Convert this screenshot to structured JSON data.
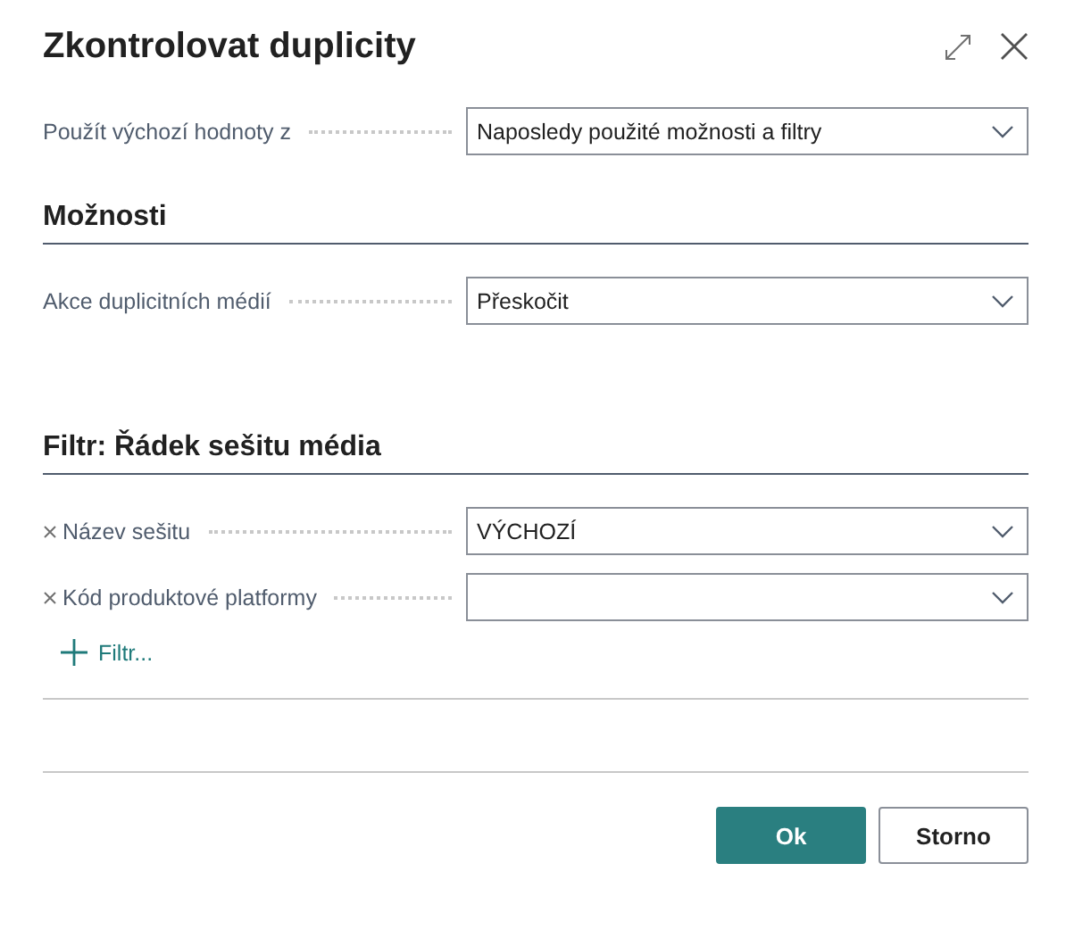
{
  "window": {
    "title": "Zkontrolovat duplicity"
  },
  "default_row": {
    "label": "Použít výchozí hodnoty z",
    "value": "Naposledy použité možnosti a filtry"
  },
  "sections": [
    {
      "heading": "Možnosti",
      "fields": [
        {
          "label": "Akce duplicitních médií",
          "value": "Přeskočit",
          "removable": false
        }
      ]
    },
    {
      "heading": "Filtr: Řádek sešitu média",
      "fields": [
        {
          "label": "Název sešitu",
          "value": "VÝCHOZÍ",
          "removable": true
        },
        {
          "label": "Kód produktové platformy",
          "removable": true
        }
      ],
      "add_filter": "Filtr..."
    }
  ],
  "buttons": [
    {
      "label": "Ok",
      "kind": "primary"
    },
    {
      "label": "Storno",
      "kind": "secondary"
    }
  ]
}
